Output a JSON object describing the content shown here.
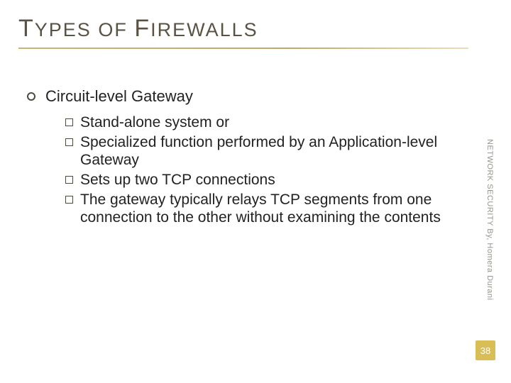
{
  "title_parts": {
    "p1_big": "T",
    "p1_rest": "YPES",
    "p2": "OF",
    "p3_big": "F",
    "p3_rest": "IREWALLS"
  },
  "main_bullet": "Circuit-level Gateway",
  "subitems": [
    "Stand-alone system or",
    "Specialized function performed by an Application-level Gateway",
    "Sets up two TCP connections",
    "The gateway typically relays TCP segments from one connection to the other without examining the contents"
  ],
  "side_label": "NETWORK SECURITY   By, Homera Durani",
  "page_number": "38"
}
